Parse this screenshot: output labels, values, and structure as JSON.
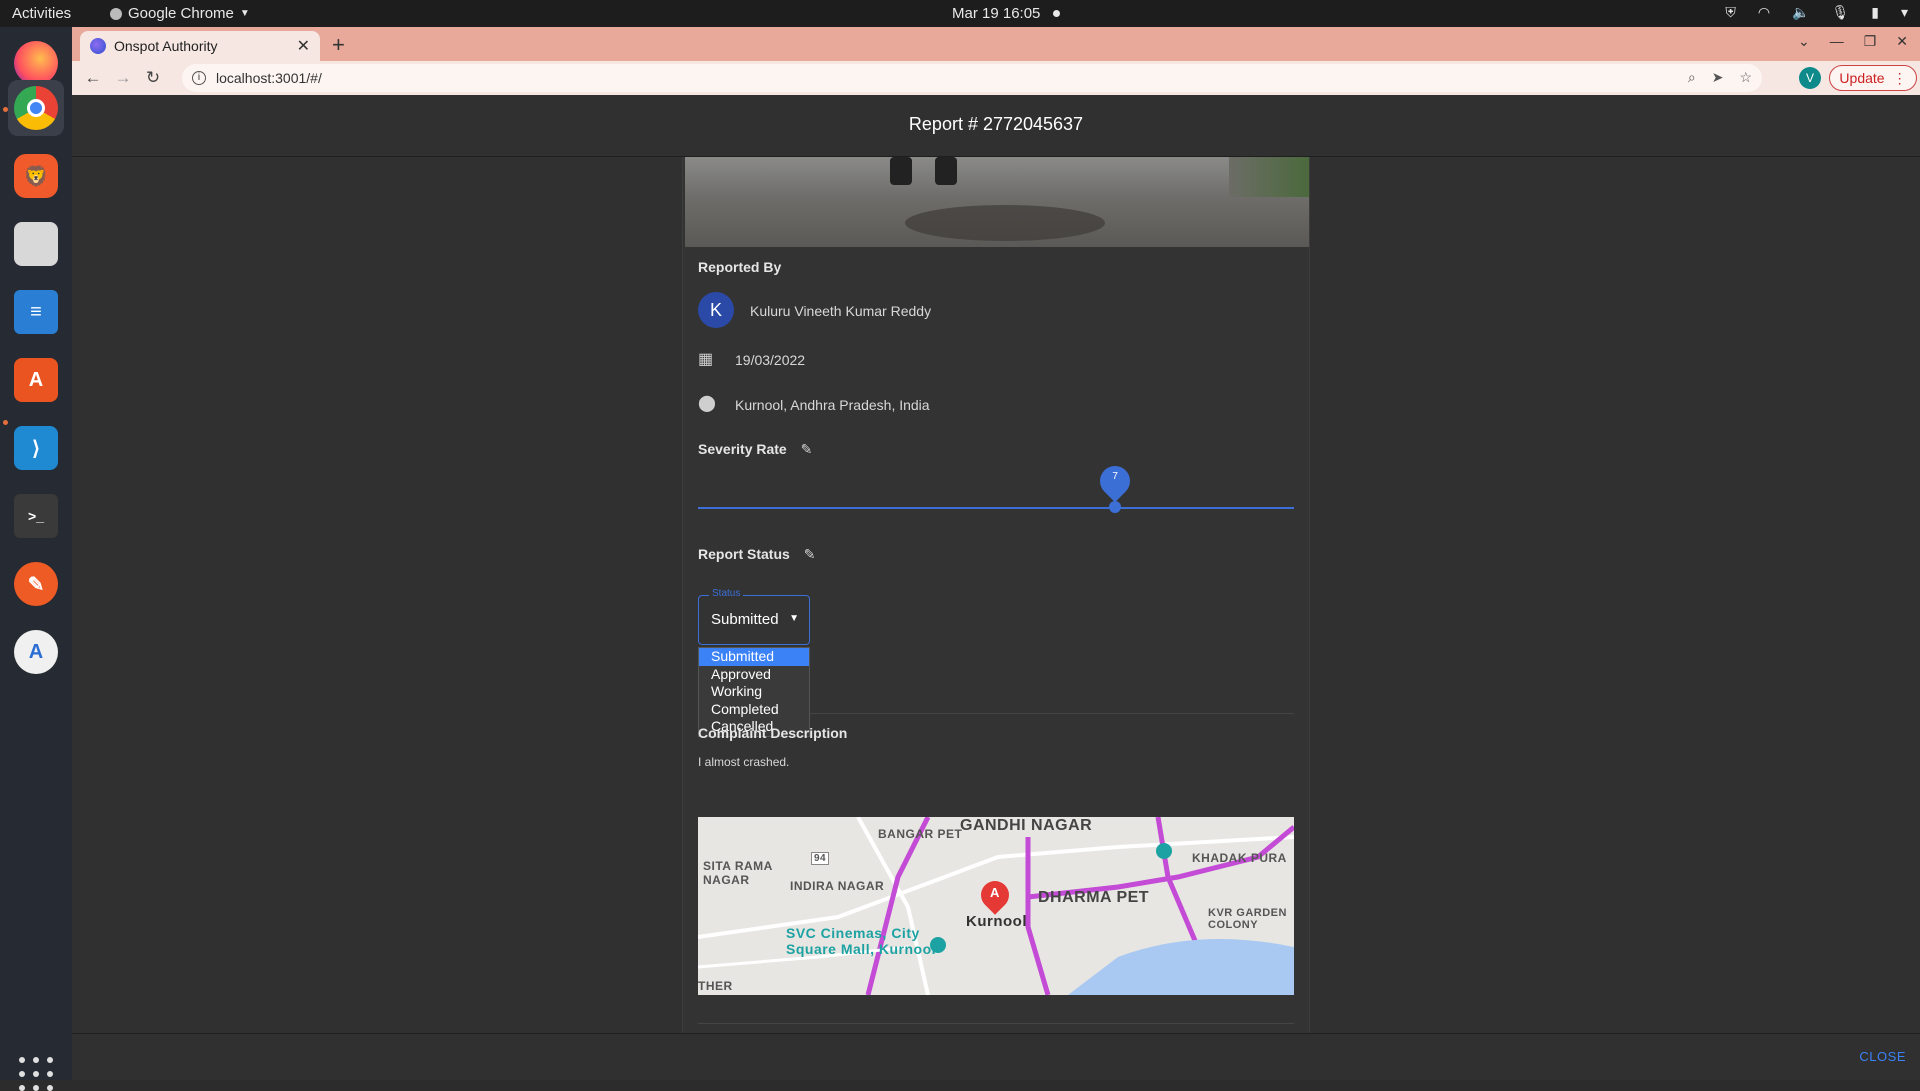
{
  "system": {
    "activities": "Activities",
    "app_menu": "Google Chrome",
    "clock": "Mar 19  16:05"
  },
  "browser": {
    "tab_title": "Onspot Authority",
    "url": "localhost:3001/#/",
    "profile_initial": "V",
    "update_label": "Update"
  },
  "report": {
    "header": "Report # 2772045637",
    "reported_by_title": "Reported By",
    "reporter_initial": "K",
    "reporter_name": "Kuluru Vineeth Kumar Reddy",
    "date": "19/03/2022",
    "location": "Kurnool, Andhra Pradesh, India",
    "severity_title": "Severity Rate",
    "severity_value": 7,
    "severity_max": 10,
    "severity_label": "7",
    "status_title": "Report Status",
    "status_field_label": "Status",
    "status_value": "Submitted",
    "status_options": [
      "Submitted",
      "Approved",
      "Working",
      "Completed",
      "Cancelled"
    ],
    "partially_hidden_link": "s",
    "complaint_title": "Complaint Description",
    "complaint_text": "I almost crashed."
  },
  "map": {
    "labels": {
      "gandhi_nagar": "GANDHI NAGAR",
      "bangar_pet": "BANGAR PET",
      "sita_rama_nagar": "SITA RAMA\nNAGAR",
      "indira_nagar": "INDIRA NAGAR",
      "dharma_pet": "DHARMA PET",
      "khadak_pura": "KHADAK PURA",
      "kvr_garden": "KVR GARDEN\nCOLONY",
      "kurnool": "Kurnool",
      "svc": "SVC Cinemas, City\nSquare Mall, Kurnool",
      "other": "THER",
      "marker": "A",
      "road_94": "94"
    }
  },
  "footer": {
    "close_label": "CLOSE"
  },
  "colors": {
    "accent": "#3b82f6",
    "dialog_bg": "#303030",
    "card_bg": "#333333"
  }
}
